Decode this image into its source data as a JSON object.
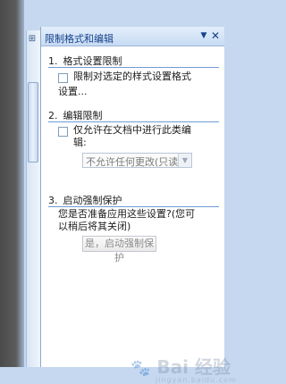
{
  "pane": {
    "title": "限制格式和编辑",
    "dropdown_icon": "triangle-down-icon",
    "close_icon": "close-icon"
  },
  "section1": {
    "number": "1.",
    "heading": "格式设置限制",
    "checkbox_label_line1": "限制对选定的样式设置格式",
    "checkbox_label_line2": "设置..."
  },
  "section2": {
    "number": "2.",
    "heading": "编辑限制",
    "checkbox_label_line1": "仅允许在文档中进行此类编",
    "checkbox_label_line2": "辑:",
    "select_value": "不允许任何更改(只读)"
  },
  "section3": {
    "number": "3.",
    "heading": "启动强制保护",
    "question_line1": "您是否准备应用这些设置?(您可",
    "question_line2": "以稍后将其关闭)",
    "button_label": "是，启动强制保护"
  },
  "watermark": {
    "text": "Bai 经验",
    "sub": "jingyan.baidu.com"
  },
  "colors": {
    "accent": "#15428b",
    "rule": "#6f9bd2",
    "background": "#c5d8ef"
  }
}
